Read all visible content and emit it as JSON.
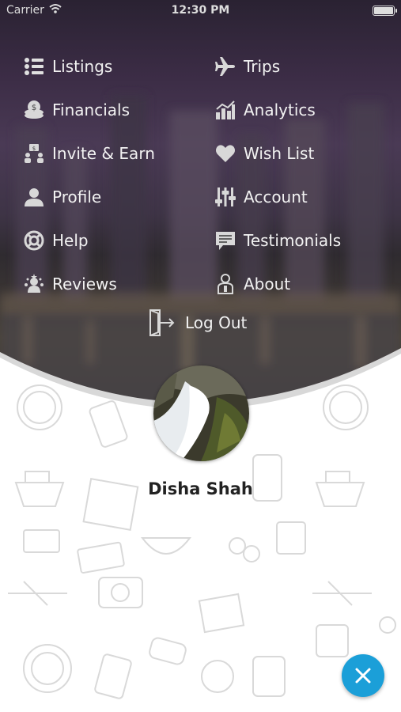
{
  "status_bar": {
    "carrier": "Carrier",
    "time": "12:30 PM"
  },
  "menu": {
    "left": [
      {
        "label": "Listings",
        "icon": "list-icon"
      },
      {
        "label": "Financials",
        "icon": "coins-icon"
      },
      {
        "label": "Invite & Earn",
        "icon": "invite-icon"
      },
      {
        "label": "Profile",
        "icon": "person-icon"
      },
      {
        "label": "Help",
        "icon": "lifebuoy-icon"
      },
      {
        "label": "Reviews",
        "icon": "reviews-icon"
      }
    ],
    "right": [
      {
        "label": "Trips",
        "icon": "airplane-icon"
      },
      {
        "label": "Analytics",
        "icon": "bar-chart-icon"
      },
      {
        "label": "Wish List",
        "icon": "heart-icon"
      },
      {
        "label": "Account",
        "icon": "sliders-icon"
      },
      {
        "label": "Testimonials",
        "icon": "comment-icon"
      },
      {
        "label": "About",
        "icon": "about-icon"
      }
    ],
    "logout": {
      "label": "Log Out",
      "icon": "logout-icon"
    }
  },
  "profile": {
    "name": "Disha Shah"
  },
  "colors": {
    "accent": "#1b9fd8",
    "menu_text": "#f2f2f2",
    "name_text": "#222222"
  }
}
